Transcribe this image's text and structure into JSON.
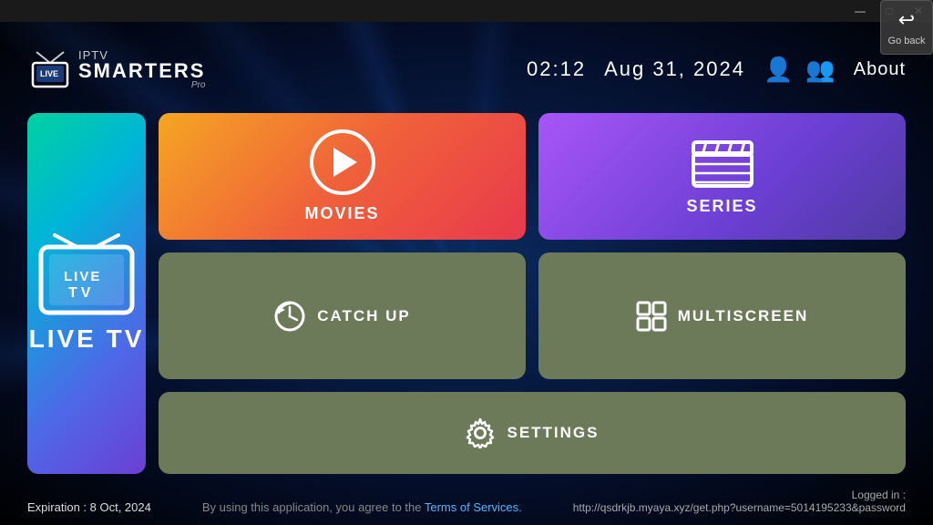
{
  "titlebar": {
    "minimize": "—",
    "maximize": "□",
    "close": "✕"
  },
  "goback": {
    "label": "Go back"
  },
  "header": {
    "logo": {
      "iptv": "IPTV",
      "smarters": "SMARTERS",
      "pro": "Pro"
    },
    "time": "02:12",
    "date": "Aug 31, 2024",
    "about": "About"
  },
  "cards": {
    "live_tv": "LIVE TV",
    "movies": "MOVIES",
    "series": "SERIES",
    "catch_up": "CATCH UP",
    "multiscreen": "MULTISCREEN",
    "settings": "SETTINGS"
  },
  "footer": {
    "expiry": "Expiration : 8 Oct, 2024",
    "terms_prefix": "By using this application, you agree to the ",
    "terms_link": "Terms of Services.",
    "logged_in_label": "Logged in :",
    "logged_in_url": "http://qsdrkjb.myaya.xyz/get.php?username=5014195233&password"
  }
}
